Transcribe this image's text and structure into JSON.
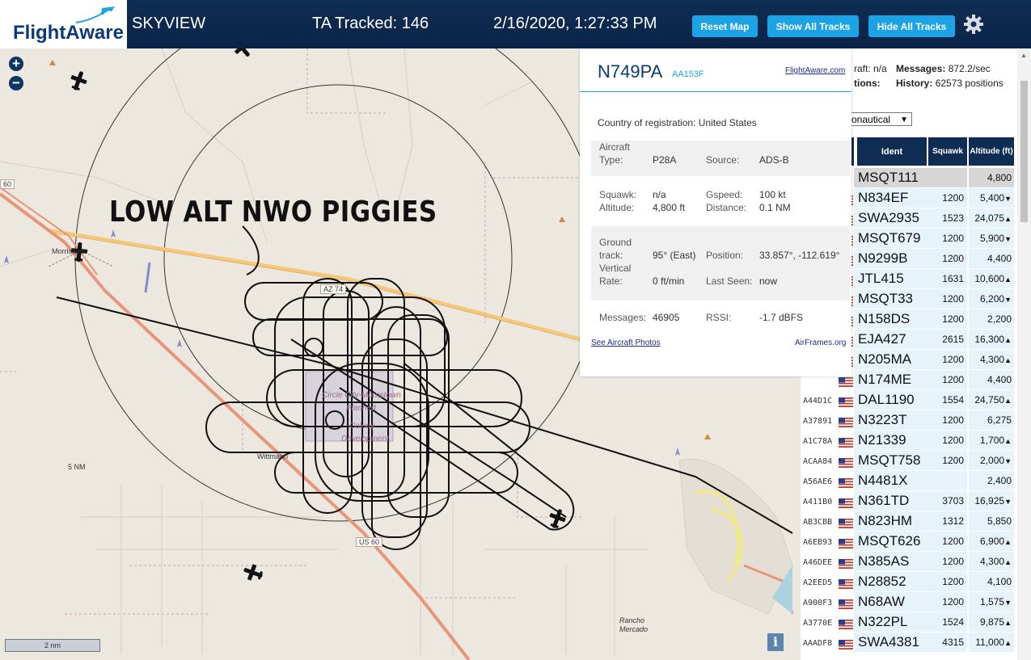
{
  "header": {
    "logo_text": "FlightAware",
    "title": "SKYVIEW",
    "tracked": "TA Tracked: 146",
    "datetime": "2/16/2020, 1:27:33 PM",
    "buttons": {
      "reset": "Reset Map",
      "show_all": "Show All Tracks",
      "hide_all": "Hide All Tracks"
    },
    "icons": {
      "settings": "gear-icon"
    }
  },
  "map": {
    "zoom_in": "+",
    "zoom_out": "−",
    "annotation": "LOW ALT NWO PIGGIES",
    "range_label": "5 NM",
    "scale_label": "2 nm",
    "info": "i",
    "labels": {
      "morristown": "Morristown",
      "wittmann": "Wittmann",
      "rancho": "Rancho",
      "mercado": "Mercado",
      "az74": "AZ 74",
      "us60": "US 60",
      "r60": "60",
      "circle_city": "Circle City-Morristown",
      "planned": "Planned",
      "colony": "Colony",
      "development": "Development"
    },
    "colors": {
      "land": "#ede8df",
      "track": "#111111",
      "highway": "#e8967a",
      "az74_road": "#f5c879",
      "boundary": "#c9a0c0"
    }
  },
  "popup": {
    "ident": "N749PA",
    "hex": "AA153F",
    "fa_link": "FlightAware.com",
    "country_label": "Country of registration:",
    "country": "United States",
    "fields": {
      "aircraft_type_label": "Aircraft Type:",
      "aircraft_type": "P28A",
      "source_label": "Source:",
      "source": "ADS-B",
      "squawk_label": "Squawk:",
      "squawk": "n/a",
      "altitude_label": "Altitude:",
      "altitude": "4,800 ft",
      "gspeed_label": "Gspeed:",
      "gspeed": "100 kt",
      "distance_label": "Distance:",
      "distance": "0.1 NM",
      "ground_track_label": "Ground track:",
      "ground_track": "95° (East)",
      "position_label": "Position:",
      "position": "33.857°, -112.619°",
      "vertical_rate_label": "Vertical Rate:",
      "vertical_rate": "0 ft/min",
      "last_seen_label": "Last Seen:",
      "last_seen": "now",
      "messages_label": "Messages:",
      "messages": "46905",
      "rssi_label": "RSSI:",
      "rssi": "-1.7 dBFS"
    },
    "see_photos": "See Aircraft Photos",
    "airframes": "AirFrames.org"
  },
  "stats": {
    "aircraft_partial": "raft: n/a",
    "positions_partial": "tions:",
    "messages_label": "Messages:",
    "messages_value": "872.2/sec",
    "history_label": "History:",
    "history_value": "62573 positions",
    "map_select": "ronautical"
  },
  "table": {
    "headers": {
      "ident": "Ident",
      "squawk": "Squawk",
      "altitude": "Altitude (ft)"
    },
    "rows": [
      {
        "hex": "",
        "flag": false,
        "ident": "MSQT111",
        "squawk": "",
        "alt": "4,800",
        "trend": "",
        "selected": true
      },
      {
        "hex": "",
        "flag": true,
        "ident": "N834EF",
        "squawk": "1200",
        "alt": "5,400",
        "trend": "▼"
      },
      {
        "hex": "",
        "flag": true,
        "ident": "SWA2935",
        "squawk": "1523",
        "alt": "24,075",
        "trend": "▲"
      },
      {
        "hex": "",
        "flag": true,
        "ident": "MSQT679",
        "squawk": "1200",
        "alt": "5,900",
        "trend": "▼"
      },
      {
        "hex": "",
        "flag": true,
        "ident": "N9299B",
        "squawk": "1200",
        "alt": "4,400",
        "trend": ""
      },
      {
        "hex": "",
        "flag": true,
        "ident": "JTL415",
        "squawk": "1631",
        "alt": "10,600",
        "trend": "▲"
      },
      {
        "hex": "",
        "flag": true,
        "ident": "MSQT33",
        "squawk": "1200",
        "alt": "6,200",
        "trend": "▼"
      },
      {
        "hex": "",
        "flag": true,
        "ident": "N158DS",
        "squawk": "1200",
        "alt": "2,200",
        "trend": ""
      },
      {
        "hex": "",
        "flag": true,
        "ident": "EJA427",
        "squawk": "2615",
        "alt": "16,300",
        "trend": "▲"
      },
      {
        "hex": "",
        "flag": true,
        "ident": "N205MA",
        "squawk": "1200",
        "alt": "4,300",
        "trend": "▲"
      },
      {
        "hex": "",
        "flag": true,
        "ident": "N174ME",
        "squawk": "1200",
        "alt": "4,400",
        "trend": ""
      },
      {
        "hex": "A44D1C",
        "flag": true,
        "ident": "DAL1190",
        "squawk": "1554",
        "alt": "24,750",
        "trend": "▲"
      },
      {
        "hex": "A37891",
        "flag": true,
        "ident": "N3223T",
        "squawk": "1200",
        "alt": "6,275",
        "trend": ""
      },
      {
        "hex": "A1C78A",
        "flag": true,
        "ident": "N21339",
        "squawk": "1200",
        "alt": "1,700",
        "trend": "▲"
      },
      {
        "hex": "ACAA84",
        "flag": true,
        "ident": "MSQT758",
        "squawk": "1200",
        "alt": "2,000",
        "trend": "▼"
      },
      {
        "hex": "A56AE6",
        "flag": true,
        "ident": "N4481X",
        "squawk": "",
        "alt": "2,400",
        "trend": ""
      },
      {
        "hex": "A411B0",
        "flag": true,
        "ident": "N361TD",
        "squawk": "3703",
        "alt": "16,925",
        "trend": "▼"
      },
      {
        "hex": "AB3CBB",
        "flag": true,
        "ident": "N823HM",
        "squawk": "1312",
        "alt": "5,850",
        "trend": ""
      },
      {
        "hex": "A6EB93",
        "flag": true,
        "ident": "MSQT626",
        "squawk": "1200",
        "alt": "6,900",
        "trend": "▲"
      },
      {
        "hex": "A46DEE",
        "flag": true,
        "ident": "N385AS",
        "squawk": "1200",
        "alt": "4,300",
        "trend": "▲"
      },
      {
        "hex": "A2EED5",
        "flag": true,
        "ident": "N28852",
        "squawk": "1200",
        "alt": "4,100",
        "trend": ""
      },
      {
        "hex": "A900F3",
        "flag": true,
        "ident": "N68AW",
        "squawk": "1200",
        "alt": "1,575",
        "trend": "▼"
      },
      {
        "hex": "A3770E",
        "flag": true,
        "ident": "N322PL",
        "squawk": "1524",
        "alt": "9,875",
        "trend": "▲"
      },
      {
        "hex": "AAADF8",
        "flag": true,
        "ident": "SWA4381",
        "squawk": "4315",
        "alt": "11,000",
        "trend": "▲"
      }
    ]
  }
}
